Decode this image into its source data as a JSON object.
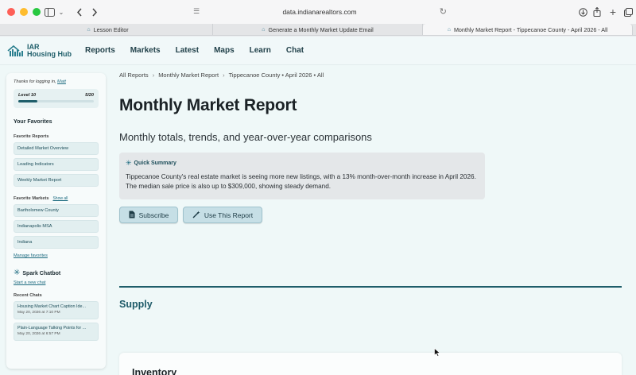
{
  "browser": {
    "url": "data.indianarealtors.com",
    "tabs": [
      {
        "label": "Lesson Editor",
        "active": false
      },
      {
        "label": "Generate a Monthly Market Update Email",
        "active": false
      },
      {
        "label": "Monthly Market Report - Tippecanoe County - April 2026 - All",
        "active": true
      }
    ]
  },
  "site": {
    "logo_line1": "IAR",
    "logo_line2": "Housing Hub",
    "nav": [
      "Reports",
      "Markets",
      "Latest",
      "Maps",
      "Learn",
      "Chat"
    ]
  },
  "sidebar": {
    "thanks_prefix": "Thanks for logging in,",
    "user": "Matt",
    "level_label": "Level 10",
    "level_progress": "5/20",
    "level_fraction": 0.25,
    "favorites_heading": "Your Favorites",
    "fav_reports_heading": "Favorite Reports",
    "fav_reports": [
      "Detailed Market Overview",
      "Leading Indicators",
      "Weekly Market Report"
    ],
    "fav_markets_heading": "Favorite Markets",
    "show_all": "Show all",
    "fav_markets": [
      "Bartholomew County",
      "Indianapolis MSA",
      "Indiana"
    ],
    "manage_favorites": "Manage favorites",
    "chatbot_heading": "Spark Chatbot",
    "start_chat": "Start a new chat",
    "recent_chats_heading": "Recent Chats",
    "recent_chats": [
      {
        "title": "Housing Market Chart Caption Ide...",
        "date": "May 20, 2026 at 7:10 PM"
      },
      {
        "title": "Plain-Language Talking Points for ...",
        "date": "May 20, 2026 at 6:57 PM"
      }
    ]
  },
  "main": {
    "breadcrumb": [
      "All Reports",
      "Monthly Market Report",
      "Tippecanoe County • April 2026 • All"
    ],
    "title": "Monthly Market Report",
    "subtitle": "Monthly totals, trends, and year-over-year comparisons",
    "summary_heading": "Quick Summary",
    "summary_text": "Tippecanoe County's real estate market is seeing more new listings, with a 13% month-over-month increase in April 2026. The median sale price is also up to $309,000, showing steady demand.",
    "subscribe_label": "Subscribe",
    "use_report_label": "Use This Report",
    "section_heading": "Supply",
    "card_title": "Inventory"
  },
  "colors": {
    "brand": "#1f5e6a",
    "accent_link": "#1d6b80",
    "page_bg": "#eff8f8"
  }
}
